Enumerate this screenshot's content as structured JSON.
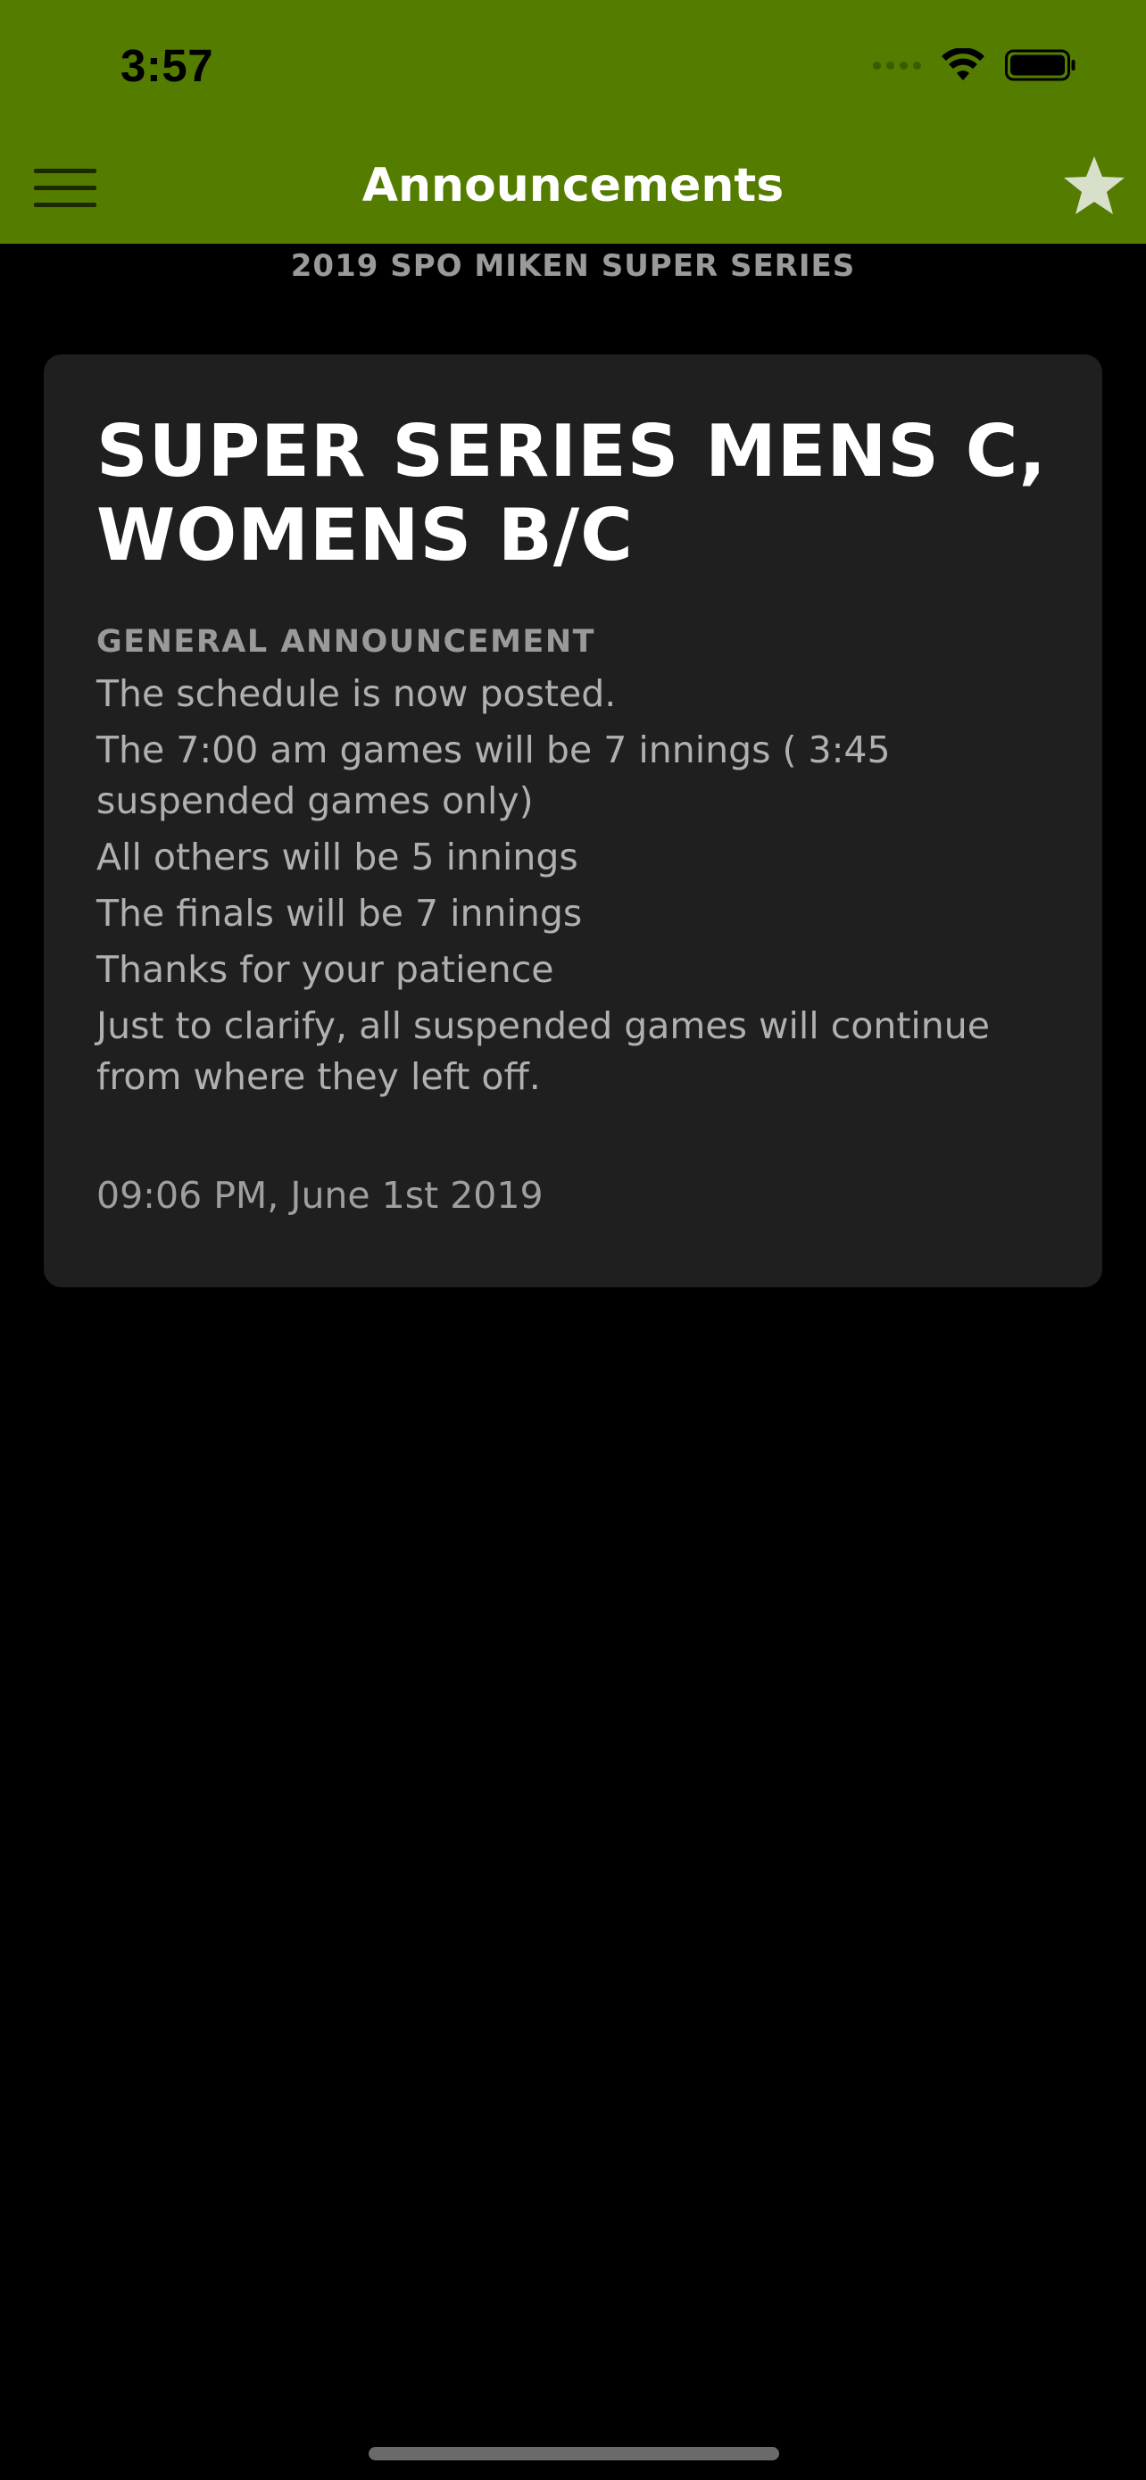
{
  "status_bar": {
    "time": "3:57"
  },
  "colors": {
    "accent": "#547d00",
    "background": "#000000",
    "card": "#1f1f1f"
  },
  "nav": {
    "title": "Announcements",
    "menu_icon": "hamburger-icon",
    "favorite_icon": "star-icon"
  },
  "event": {
    "name": "2019 SPO MIKEN SUPER SERIES"
  },
  "announcement": {
    "title": "SUPER SERIES MENS C, WOMENS B/C",
    "category": "GENERAL ANNOUNCEMENT",
    "lines": [
      "The schedule is now posted.",
      "The 7:00 am games will be 7 innings ( 3:45 suspended games only)",
      "All others will be 5 innings",
      "The finals will be 7 innings",
      "Thanks for your patience",
      "Just to clarify, all suspended games will continue from where they left off."
    ],
    "date": "09:06 PM, June 1st 2019"
  }
}
